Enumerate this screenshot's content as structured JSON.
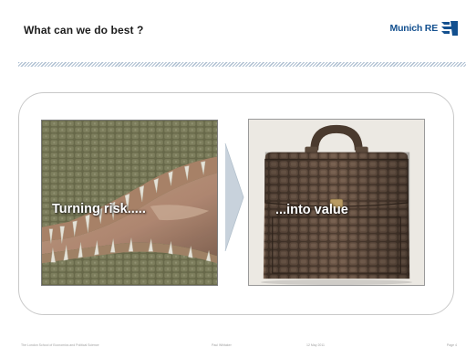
{
  "slide": {
    "title": "What can we do best ?",
    "logo_text": "Munich RE",
    "left_caption": "Turning risk.....",
    "right_caption": "...into value",
    "footer": {
      "institution": "The London School of Economics and Political Science",
      "author": "Paul Whitaker",
      "date": "12 May 2011",
      "page": "Page 4"
    }
  },
  "colors": {
    "title": "#1c1c1c",
    "brand_blue": "#13508f",
    "divider": "#9fb4c9",
    "panel_border": "#c9c9c9",
    "arrow": "#c8d2dc"
  },
  "icons": {
    "logo_mark": "munich-re-logo-icon",
    "arrow": "chevron-right-arrow-icon"
  }
}
